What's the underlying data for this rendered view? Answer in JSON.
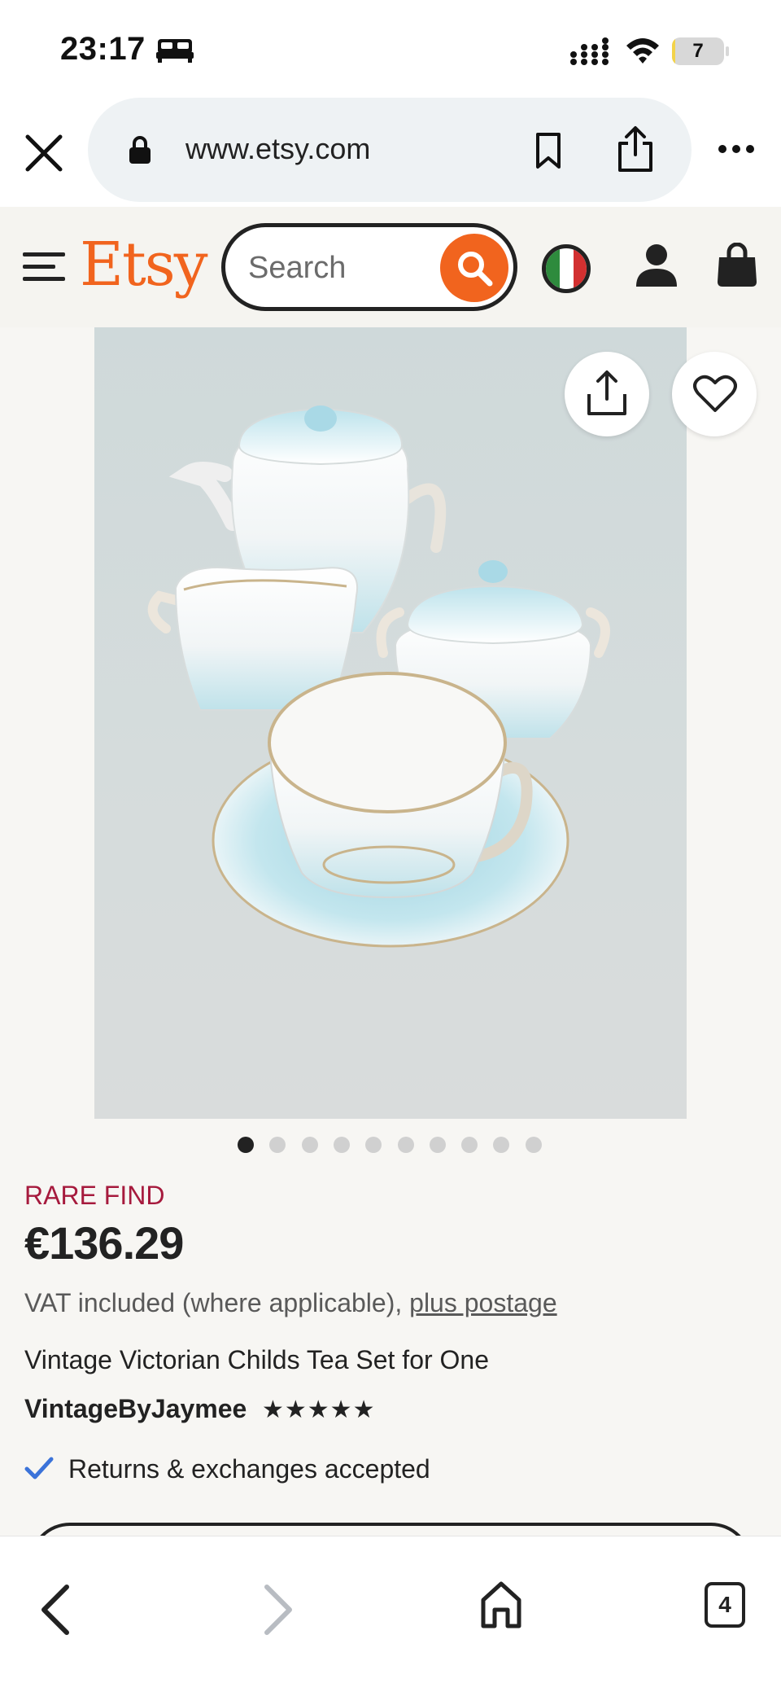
{
  "status_bar": {
    "time": "23:17",
    "battery": "7",
    "battery_level_percent": 7
  },
  "browser": {
    "url": "www.etsy.com"
  },
  "header": {
    "logo": "Etsy",
    "search_placeholder": "Search",
    "brand_color": "#f1641e"
  },
  "listing": {
    "image_dots_count": 10,
    "active_image_index": 0,
    "badge": "RARE FIND",
    "price": "€136.29",
    "vat_text": "VAT included (where applicable), ",
    "postage_link": "plus postage",
    "title": "Vintage Victorian Childs Tea Set for One",
    "shop_name": "VintageByJaymee",
    "rating_stars": "★★★★★",
    "rating_value": 5,
    "returns_text": "Returns & exchanges accepted"
  },
  "toolbar": {
    "tabs_count": "4"
  },
  "icons": [
    "bed-icon",
    "signal-icon",
    "wifi-icon",
    "battery-icon",
    "close-icon",
    "lock-icon",
    "bookmark-icon",
    "share-icon",
    "more-icon",
    "menu-icon",
    "search-icon",
    "italy-flag-icon",
    "user-icon",
    "bag-icon",
    "heart-icon",
    "check-icon",
    "back-icon",
    "forward-icon",
    "home-icon",
    "tabs-icon"
  ]
}
